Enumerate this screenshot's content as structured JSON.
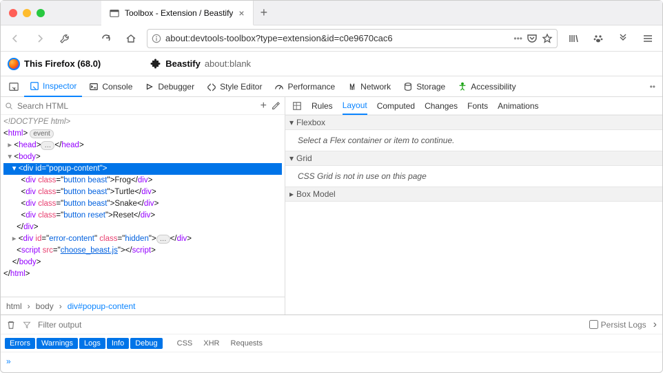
{
  "window": {
    "tab_title": "Toolbox - Extension / Beastify",
    "url": "about:devtools-toolbox?type=extension&id=c0e9670cac6"
  },
  "ext_bar": {
    "firefox_label": "This Firefox (68.0)",
    "ext_name": "Beastify",
    "ext_target": "about:blank"
  },
  "devtools_tabs": [
    "Inspector",
    "Console",
    "Debugger",
    "Style Editor",
    "Performance",
    "Network",
    "Storage",
    "Accessibility"
  ],
  "search_placeholder": "Search HTML",
  "dom": {
    "doctype": "<!DOCTYPE html>",
    "html_open": "html",
    "head": "head",
    "body": "body",
    "popup_id": "popup-content",
    "button_class": "button beast",
    "reset_class": "button reset",
    "beasts": [
      "Frog",
      "Turtle",
      "Snake"
    ],
    "reset_label": "Reset",
    "error_id": "error-content",
    "error_class": "hidden",
    "script_src": "choose_beast.js",
    "event_badge": "event",
    "ellipsis": "…"
  },
  "breadcrumbs": [
    "html",
    "body",
    "div#popup-content"
  ],
  "side_tabs": [
    "Rules",
    "Layout",
    "Computed",
    "Changes",
    "Fonts",
    "Animations"
  ],
  "layout_panel": {
    "flexbox_title": "Flexbox",
    "flexbox_msg": "Select a Flex container or item to continue.",
    "grid_title": "Grid",
    "grid_msg": "CSS Grid is not in use on this page",
    "boxmodel_title": "Box Model"
  },
  "console": {
    "filter_placeholder": "Filter output",
    "persist_label": "Persist Logs",
    "chips": [
      "Errors",
      "Warnings",
      "Logs",
      "Info",
      "Debug"
    ],
    "off_chips": [
      "CSS",
      "XHR",
      "Requests"
    ],
    "prompt": "»"
  }
}
